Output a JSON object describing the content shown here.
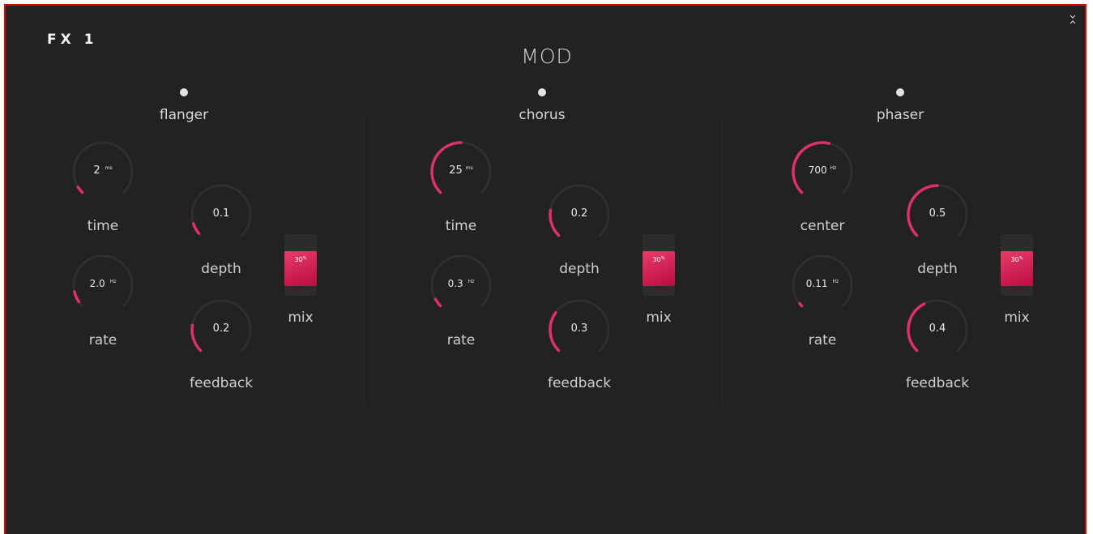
{
  "panel": {
    "title": "FX 1",
    "category": "MOD",
    "accent": "#e0306a",
    "border": "#d10f0f"
  },
  "collapse_icon": "collapse-arrows-icon",
  "sections": [
    {
      "name": "flanger",
      "knobs": [
        {
          "id": "time",
          "label": "time",
          "value": "2",
          "unit": "ms",
          "fill": 0.05
        },
        {
          "id": "rate",
          "label": "rate",
          "value": "2.0",
          "unit": "Hz",
          "fill": 0.12
        },
        {
          "id": "depth",
          "label": "depth",
          "value": "0.1",
          "unit": "",
          "fill": 0.1
        },
        {
          "id": "feedback",
          "label": "feedback",
          "value": "0.2",
          "unit": "",
          "fill": 0.2
        }
      ],
      "mix": {
        "label": "mix",
        "value": "30",
        "unit": "%",
        "fill": 0.57
      }
    },
    {
      "name": "chorus",
      "knobs": [
        {
          "id": "time",
          "label": "time",
          "value": "25",
          "unit": "ms",
          "fill": 0.5
        },
        {
          "id": "rate",
          "label": "rate",
          "value": "0.3",
          "unit": "Hz",
          "fill": 0.06
        },
        {
          "id": "depth",
          "label": "depth",
          "value": "0.2",
          "unit": "",
          "fill": 0.2
        },
        {
          "id": "feedback",
          "label": "feedback",
          "value": "0.3",
          "unit": "",
          "fill": 0.3
        }
      ],
      "mix": {
        "label": "mix",
        "value": "30",
        "unit": "%",
        "fill": 0.57
      }
    },
    {
      "name": "phaser",
      "knobs": [
        {
          "id": "center",
          "label": "center",
          "value": "700",
          "unit": "Hz",
          "fill": 0.55
        },
        {
          "id": "rate",
          "label": "rate",
          "value": "0.11",
          "unit": "Hz",
          "fill": 0.02
        },
        {
          "id": "depth",
          "label": "depth",
          "value": "0.5",
          "unit": "",
          "fill": 0.5
        },
        {
          "id": "feedback",
          "label": "feedback",
          "value": "0.4",
          "unit": "",
          "fill": 0.4
        }
      ],
      "mix": {
        "label": "mix",
        "value": "30",
        "unit": "%",
        "fill": 0.57
      }
    }
  ]
}
